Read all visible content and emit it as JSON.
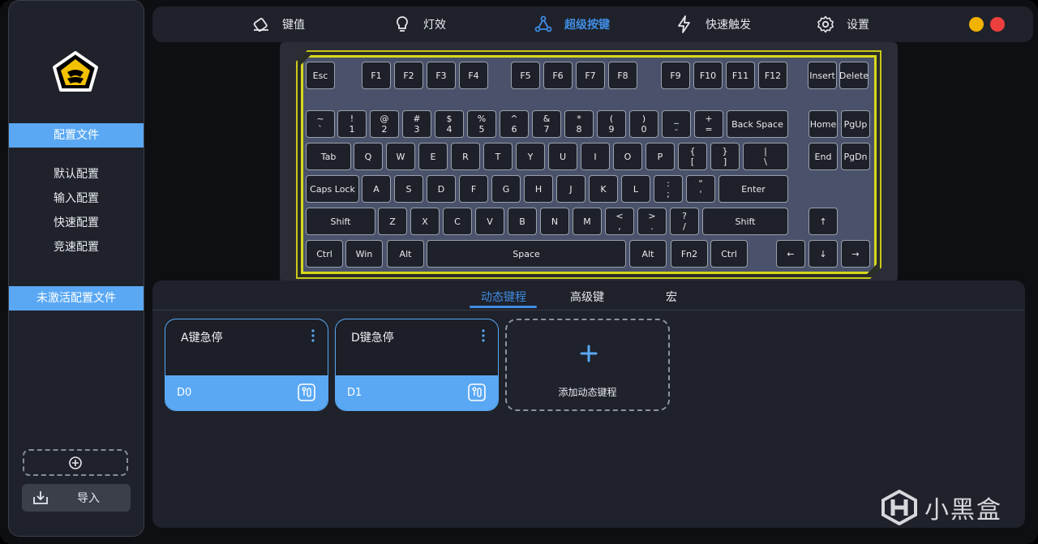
{
  "sidebar": {
    "logo": "bee-logo",
    "profile_header": "配置文件",
    "profiles": [
      "默认配置",
      "输入配置",
      "快速配置",
      "竞速配置"
    ],
    "inactive_header": "未激活配置文件",
    "add_icon": "plus-circle-icon",
    "import_label": "导入",
    "import_icon": "import-tray-icon"
  },
  "nav": {
    "tabs": [
      {
        "label": "键值",
        "icon": "key-value-icon",
        "active": false
      },
      {
        "label": "灯效",
        "icon": "lightbulb-icon",
        "active": false
      },
      {
        "label": "超级按键",
        "icon": "nodes-icon",
        "active": true
      },
      {
        "label": "快速触发",
        "icon": "lightning-icon",
        "active": false
      },
      {
        "label": "设置",
        "icon": "gear-icon",
        "active": false
      }
    ],
    "window_buttons": [
      {
        "name": "minimize",
        "color": "#f2b200"
      },
      {
        "name": "close",
        "color": "#ee3f3f"
      }
    ]
  },
  "keyboard": {
    "accent_color": "#d8d81c",
    "rows": [
      [
        "Esc",
        "F1",
        "F2",
        "F3",
        "F4",
        "F5",
        "F6",
        "F7",
        "F8",
        "F9",
        "F10",
        "F11",
        "F12",
        "Insert",
        "Delete"
      ],
      [
        "~\n`",
        "!\n1",
        "@\n2",
        "#\n3",
        "$\n4",
        "%\n5",
        "^\n6",
        "&\n7",
        "*\n8",
        "(\n9",
        ")\n0",
        "_\n-",
        "+\n=",
        "Back Space",
        "Home",
        "PgUp"
      ],
      [
        "Tab",
        "Q",
        "W",
        "E",
        "R",
        "T",
        "Y",
        "U",
        "I",
        "O",
        "P",
        "{\n[",
        "}\n]",
        "|\n\\",
        "End",
        "PgDn"
      ],
      [
        "Caps Lock",
        "A",
        "S",
        "D",
        "F",
        "G",
        "H",
        "J",
        "K",
        "L",
        ":\n;",
        "\"\n'",
        "Enter"
      ],
      [
        "Shift",
        "Z",
        "X",
        "C",
        "V",
        "B",
        "N",
        "M",
        "<\n,",
        ">\n.",
        "?\n/",
        "Shift",
        "↑"
      ],
      [
        "Ctrl",
        "Win",
        "Alt",
        "Space",
        "Alt",
        "Fn2",
        "Ctrl",
        "←",
        "↓",
        "→"
      ]
    ]
  },
  "panel": {
    "subtabs": [
      {
        "label": "动态键程",
        "active": true
      },
      {
        "label": "高级键",
        "active": false
      },
      {
        "label": "宏",
        "active": false
      }
    ],
    "cards": [
      {
        "title": "A键急停",
        "code": "D0"
      },
      {
        "title": "D键急停",
        "code": "D1"
      }
    ],
    "add_card_label": "添加动态键程",
    "accent_color": "#5aa8f3"
  },
  "watermark": {
    "text": "小黑盒",
    "icon": "heybox-logo-icon"
  }
}
